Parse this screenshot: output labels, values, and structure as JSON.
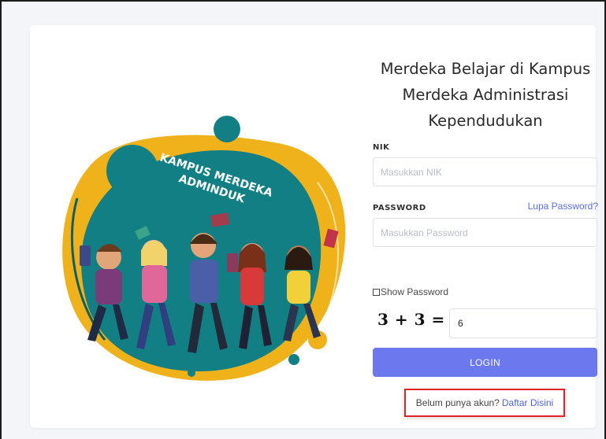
{
  "login": {
    "title_line1": "Merdeka Belajar di Kampus",
    "title_line2": "Merdeka Administrasi",
    "title_line3": "Kependudukan",
    "nik_label": "NIK",
    "nik_placeholder": "Masukkan NIK",
    "nik_value": "",
    "password_label": "PASSWORD",
    "forgot_password": "Lupa Password?",
    "password_placeholder": "Masukkan Password",
    "password_value": "",
    "show_password_label": "Show Password",
    "show_password_checked": false,
    "captcha_question": "3 + 3 = ?",
    "captcha_value": "6",
    "login_button": "LOGIN",
    "register_prompt": "Belum punya akun?",
    "register_link": "Daftar Disini"
  },
  "illustration": {
    "banner_line1": "KAMPUS MERDEKA",
    "banner_line2": "ADMINDUK"
  },
  "colors": {
    "accent": "#6b78ee",
    "link": "#4e64d4",
    "highlight_border": "#e02424",
    "blob_teal": "#127f84",
    "blob_yellow": "#f0b21a"
  }
}
